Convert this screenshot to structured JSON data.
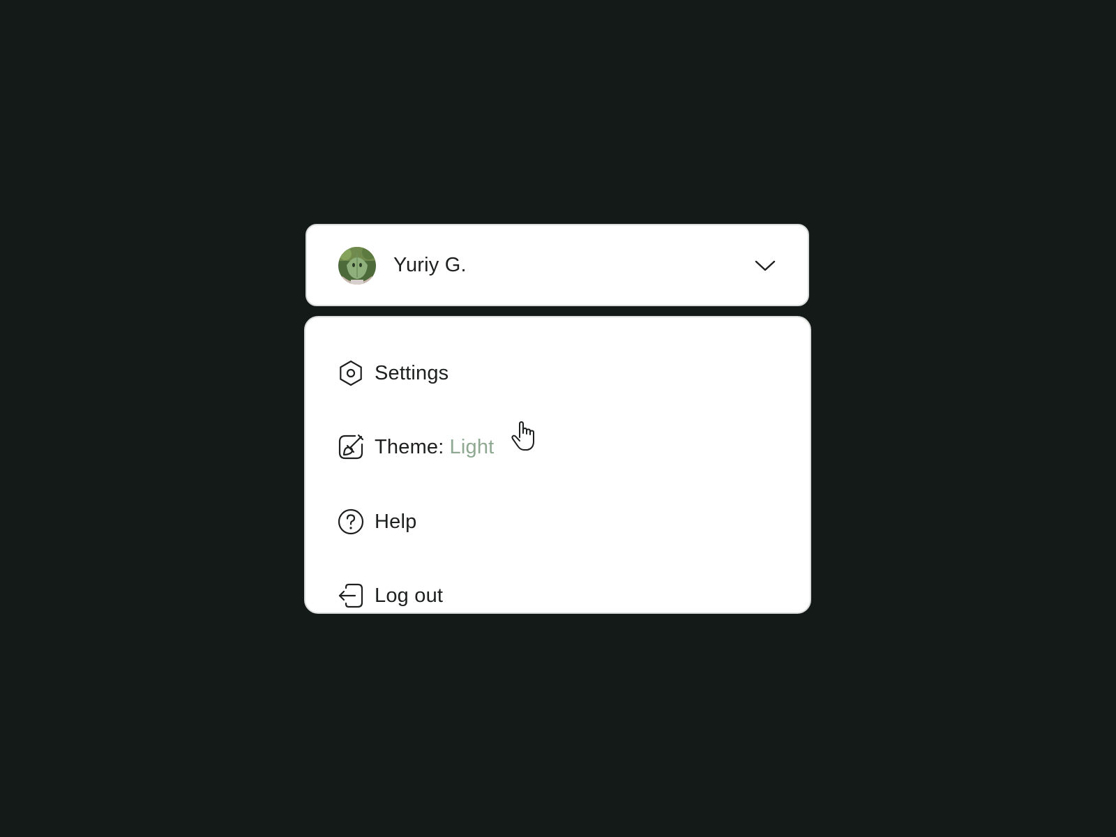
{
  "user_menu": {
    "user_name": "Yuriy G.",
    "avatar": "avatar-photo",
    "toggle_icon": "chevron-down-icon"
  },
  "menu": {
    "items": [
      {
        "label": "Settings",
        "icon": "gear-icon"
      },
      {
        "label": "Theme:",
        "value": "Light",
        "icon": "brush-icon"
      },
      {
        "label": "Help",
        "icon": "help-icon"
      },
      {
        "label": "Log out",
        "icon": "logout-icon"
      }
    ]
  },
  "cursor": {
    "type": "pointer-hand"
  },
  "colors": {
    "background": "#131a17",
    "panel": "#ffffff",
    "panel_border": "#d9ddd9",
    "text": "#1d201e",
    "accent_value": "#8ea891"
  }
}
